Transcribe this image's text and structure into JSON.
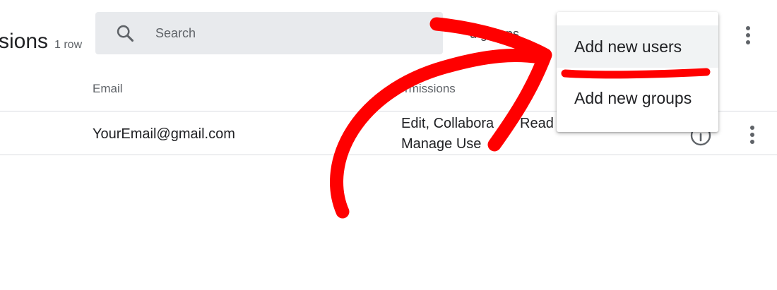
{
  "page": {
    "title": "sions",
    "row_count": "1 row"
  },
  "search": {
    "placeholder": "Search",
    "icon": "search-icon"
  },
  "toolbar": {
    "partially_hidden_text": "d groups",
    "more_icon": "more-vert-icon"
  },
  "table": {
    "columns": [
      "Email",
      "rmissions"
    ],
    "rows": [
      {
        "email": "YourEmail@gmail.com",
        "permissions_line1": "Edit, Collabora",
        "permissions_line1_b": "Read &",
        "permissions_line2": "Manage Use",
        "info_icon": "info-icon",
        "more_icon": "more-vert-icon"
      }
    ]
  },
  "menu": {
    "items": [
      "Add new users",
      "Add new groups"
    ]
  },
  "annotation": {
    "color": "#ff0000",
    "shapes": [
      "curved-arrow",
      "underline"
    ]
  }
}
